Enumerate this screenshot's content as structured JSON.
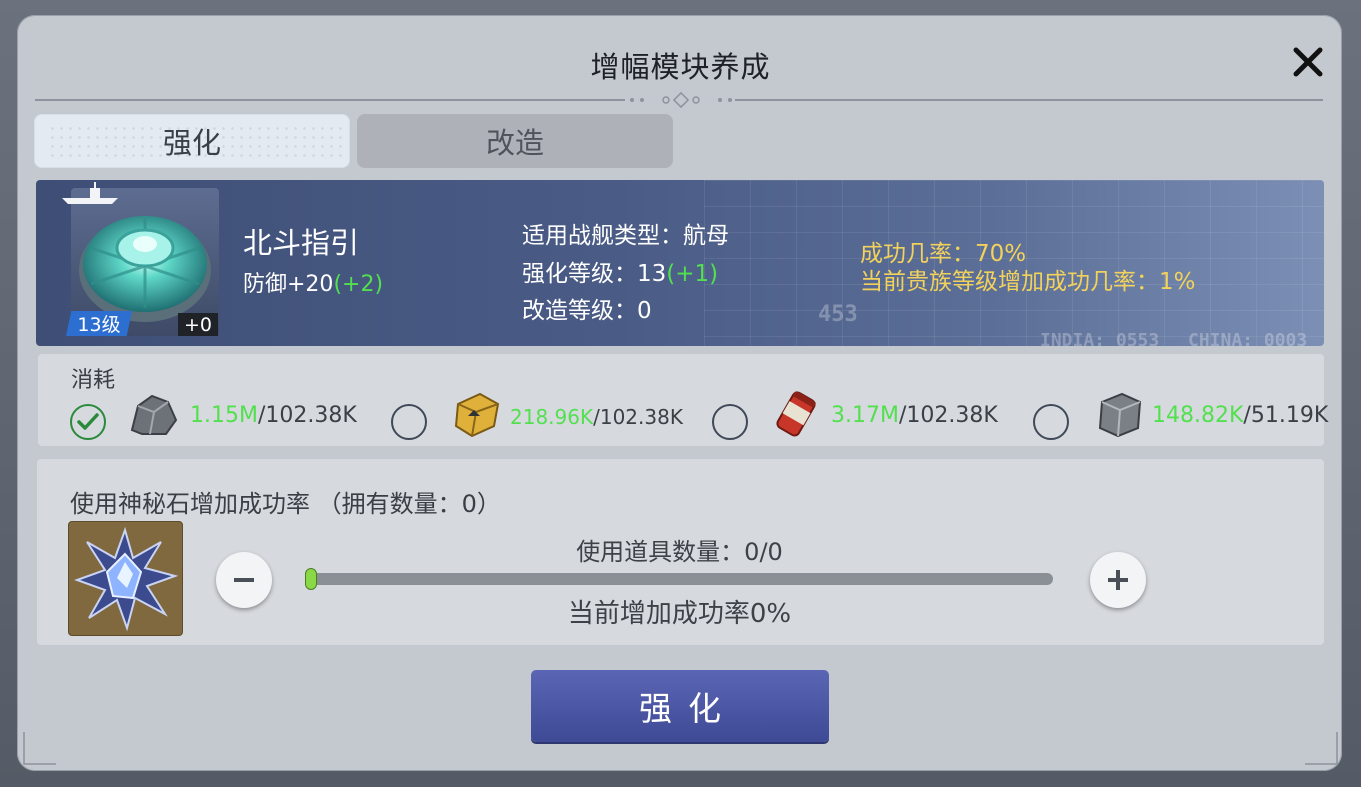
{
  "dialog": {
    "title": "增幅模块养成",
    "close_icon": "close-icon"
  },
  "tabs": [
    {
      "label": "强化",
      "active": true
    },
    {
      "label": "改造",
      "active": false
    }
  ],
  "module": {
    "name": "北斗指引",
    "stat_label": "防御+20",
    "stat_bonus": "(+2)",
    "level_badge": "13级",
    "refine_badge": "+0",
    "ship_type": "适用战舰类型：航母",
    "enhance_level_label": "强化等级：13",
    "enhance_level_bonus": "(+1)",
    "refit_level": "改造等级：0",
    "success_rate_label": "成功几率：",
    "success_rate_value": "70%",
    "noble_bonus_label": "当前贵族等级增加成功几率：",
    "noble_bonus_value": "1%",
    "deco_text_1": "453",
    "deco_text_2": "INDIA: 0553",
    "deco_text_3": "CHINA: 0003"
  },
  "costs": {
    "label": "消耗",
    "items": [
      {
        "icon": "ore-icon",
        "owned_num": "1.15",
        "owned_unit": "M",
        "required": "/102.38K",
        "checked": true
      },
      {
        "icon": "alloy-crate-icon",
        "owned_num": "218.96",
        "owned_unit": "K",
        "required": "/102.38K",
        "checked": false
      },
      {
        "icon": "fuel-canister-icon",
        "owned_num": "3.17",
        "owned_unit": "M",
        "required": "/102.38K",
        "checked": false
      },
      {
        "icon": "metal-block-icon",
        "owned_num": "148.82",
        "owned_unit": "K",
        "required": "/51.19K",
        "checked": false
      }
    ]
  },
  "mystery_stone": {
    "label": "使用神秘石增加成功率 （拥有数量：0）",
    "usage_label": "使用道具数量：0/0",
    "rate_label": "当前增加成功率0%",
    "slider_value": 0
  },
  "action": {
    "label": "强化"
  },
  "colors": {
    "accent_green": "#53e04f",
    "gold": "#f2d25a",
    "button_blue": "#4f59a6"
  }
}
